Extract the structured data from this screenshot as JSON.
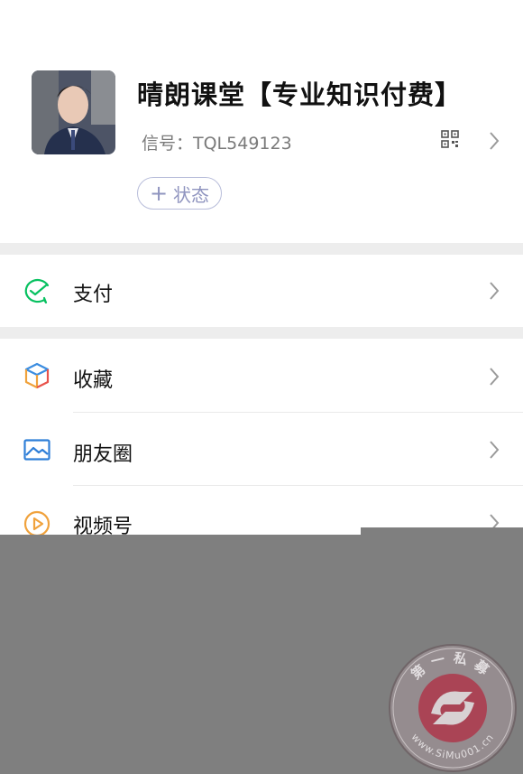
{
  "profile": {
    "name": "晴朗课堂【专业知识付费】",
    "wechat_id": "信号：TQL549123",
    "status_label": "状态",
    "status_plus": "+"
  },
  "menu": {
    "pay": "支付",
    "favorites": "收藏",
    "moments": "朋友圈",
    "channels": "视频号"
  },
  "watermark": {
    "top_text": "第一私募",
    "bottom_text": "www.SiMu001.cn"
  },
  "colors": {
    "pay_green": "#07c160",
    "moments_blue": "#2f7fd8",
    "channels_orange": "#f0a23c",
    "seal_red": "#b23a4e"
  }
}
